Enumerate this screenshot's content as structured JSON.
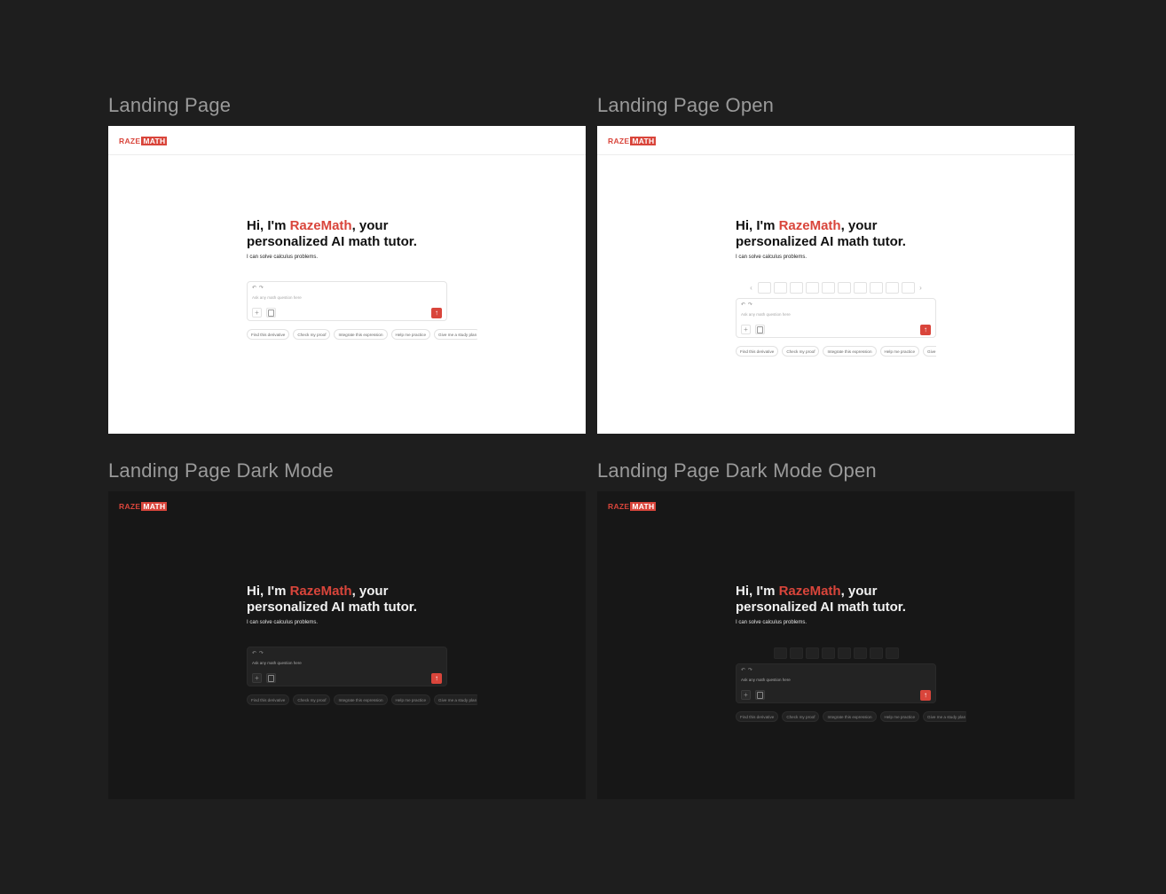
{
  "frames": [
    {
      "label": "Landing Page",
      "logo": {
        "left": "RAZE",
        "right": "MATH"
      },
      "hero": {
        "greeting_prefix": "Hi, I'm ",
        "brand": "RazeMath",
        "greeting_suffix": ", your",
        "line2": "personalized AI math tutor.",
        "subtitle": "I can solve calculus problems."
      },
      "composer": {
        "placeholder": "Ask any math question here"
      },
      "chips": [
        "Find this derivative",
        "Check my proof",
        "Integrate this expression",
        "Help me practice",
        "Give me a study plan"
      ]
    },
    {
      "label": "Landing Page Open",
      "logo": {
        "left": "RAZE",
        "right": "MATH"
      },
      "hero": {
        "greeting_prefix": "Hi, I'm ",
        "brand": "RazeMath",
        "greeting_suffix": ", your",
        "line2": "personalized AI math tutor.",
        "subtitle": "I can solve calculus problems."
      },
      "composer": {
        "placeholder": "Ask any math question here"
      },
      "chips": [
        "Find this derivative",
        "Check my proof",
        "Integrate this expression",
        "Help me practice",
        "Give me a study plan"
      ]
    },
    {
      "label": "Landing Page Dark Mode",
      "logo": {
        "left": "RAZE",
        "right": "MATH"
      },
      "hero": {
        "greeting_prefix": "Hi, I'm ",
        "brand": "RazeMath",
        "greeting_suffix": ", your",
        "line2": "personalized AI math tutor.",
        "subtitle": "I can solve calculus problems."
      },
      "composer": {
        "placeholder": "Ask any math question here"
      },
      "chips": [
        "Find this derivative",
        "Check my proof",
        "Integrate this expression",
        "Help me practice",
        "Give me a study plan"
      ]
    },
    {
      "label": "Landing Page Dark Mode Open",
      "logo": {
        "left": "RAZE",
        "right": "MATH"
      },
      "hero": {
        "greeting_prefix": "Hi, I'm ",
        "brand": "RazeMath",
        "greeting_suffix": ", your",
        "line2": "personalized AI math tutor.",
        "subtitle": "I can solve calculus problems."
      },
      "composer": {
        "placeholder": "Ask any math question here"
      },
      "chips": [
        "Find this derivative",
        "Check my proof",
        "Integrate this expression",
        "Help me practice",
        "Give me a study plan"
      ]
    }
  ],
  "icons": {
    "undo": "undo-icon",
    "redo": "redo-icon",
    "add": "plus-icon",
    "attach": "document-icon",
    "send": "arrow-up-icon",
    "prev": "chevron-left-icon",
    "next": "chevron-right-icon"
  },
  "colors": {
    "brand": "#d9453b",
    "canvas": "#1e1e1e",
    "light_bg": "#ffffff",
    "dark_bg": "#171717"
  }
}
